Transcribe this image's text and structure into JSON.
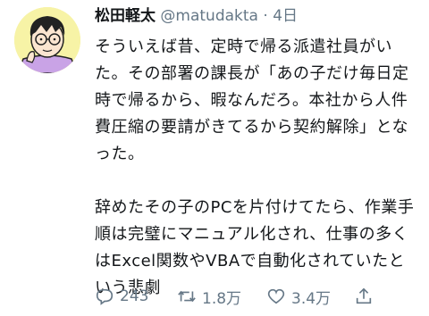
{
  "tweet": {
    "author_name": "松田軽太",
    "handle": "@matudakta",
    "separator": "·",
    "time": "4日",
    "paragraphs": [
      "そういえば昔、定時で帰る派遣社員がいた。その部署の課長が「あの子だけ毎日定時で帰るから、暇なんだろ。本社から人件費圧縮の要請がきてるから契約解除」となった。",
      "辞めたその子のPCを片付けてたら、作業手順は完璧にマニュアル化され、仕事の多くはExcel関数やVBAで自動化されていたという悲劇"
    ]
  },
  "actions": {
    "reply_count": "243",
    "retweet_count": "1.8万",
    "like_count": "3.4万"
  },
  "icons": {
    "reply": "reply-icon",
    "retweet": "retweet-icon",
    "like": "heart-icon",
    "share": "share-icon"
  },
  "colors": {
    "text": "#14171a",
    "muted": "#657786",
    "avatar_bg": "#f7f3a6"
  }
}
